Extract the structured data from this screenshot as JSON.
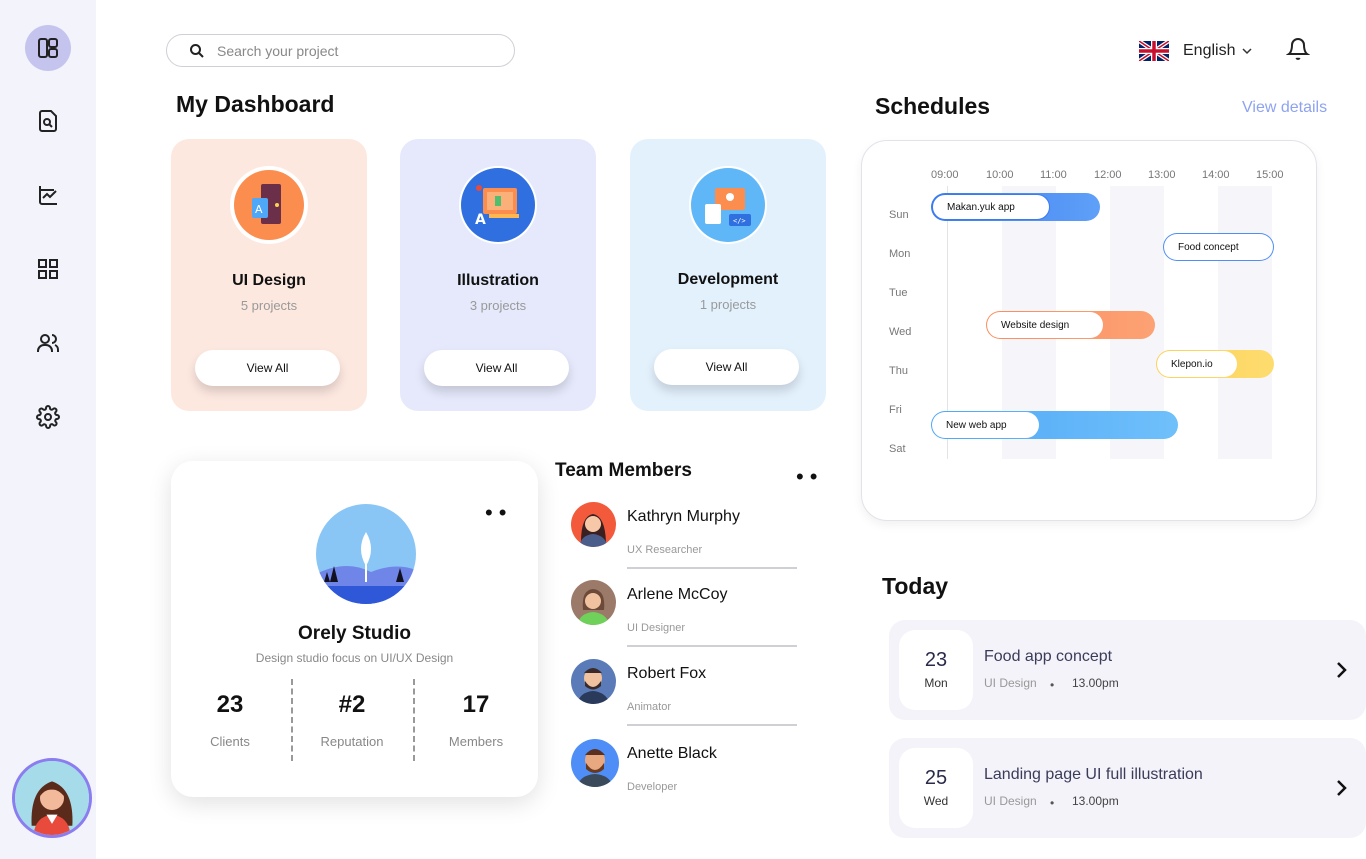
{
  "search": {
    "placeholder": "Search your project"
  },
  "header": {
    "language": "English"
  },
  "dashboard": {
    "title": "My Dashboard",
    "categories": [
      {
        "title": "UI Design",
        "subtitle": "5 projects",
        "button": "View All",
        "bg": "#fde8e0"
      },
      {
        "title": "Illustration",
        "subtitle": "3 projects",
        "button": "View All",
        "bg": "#e5e9fb"
      },
      {
        "title": "Development",
        "subtitle": "1 projects",
        "button": "View All",
        "bg": "#e3f1fd"
      }
    ]
  },
  "studio": {
    "name": "Orely Studio",
    "description": "Design studio focus on UI/UX Design",
    "stats": [
      {
        "value": "23",
        "label": "Clients"
      },
      {
        "value": "#2",
        "label": "Reputation"
      },
      {
        "value": "17",
        "label": "Members"
      }
    ]
  },
  "team": {
    "title": "Team Members",
    "members": [
      {
        "name": "Kathryn Murphy",
        "role": "UX Researcher"
      },
      {
        "name": "Arlene McCoy",
        "role": "UI Designer"
      },
      {
        "name": "Robert Fox",
        "role": "Animator"
      },
      {
        "name": "Anette Black",
        "role": "Developer"
      }
    ]
  },
  "schedules": {
    "title": "Schedules",
    "view_details": "View details",
    "times": [
      "09:00",
      "10:00",
      "11:00",
      "12:00",
      "13:00",
      "14:00",
      "15:00"
    ],
    "days": [
      "Sun",
      "Mon",
      "Tue",
      "Wed",
      "Thu",
      "Fri",
      "Sat"
    ],
    "events": [
      {
        "label": "Makan.yuk app",
        "day": "Sun",
        "start": "09:00",
        "end": "12:00",
        "color": "#4f8ef7"
      },
      {
        "label": "Food concept",
        "day": "Mon",
        "start": "13:00",
        "end": "15:00",
        "color": "#4f8ef7"
      },
      {
        "label": "Website design",
        "day": "Wed",
        "start": "10:00",
        "end": "13:00",
        "color": "#fb9a6a"
      },
      {
        "label": "Klepon.io",
        "day": "Thu",
        "start": "13:00",
        "end": "15:00",
        "color": "#fcd15b"
      },
      {
        "label": "New web app",
        "day": "Sat",
        "start": "09:00",
        "end": "13:30",
        "color": "#5fb7f8"
      }
    ]
  },
  "today": {
    "title": "Today",
    "items": [
      {
        "day": "23",
        "weekday": "Mon",
        "title": "Food app concept",
        "category": "UI Design",
        "time": "13.00pm"
      },
      {
        "day": "25",
        "weekday": "Wed",
        "title": "Landing page UI full illustration",
        "category": "UI Design",
        "time": "13.00pm"
      }
    ]
  }
}
